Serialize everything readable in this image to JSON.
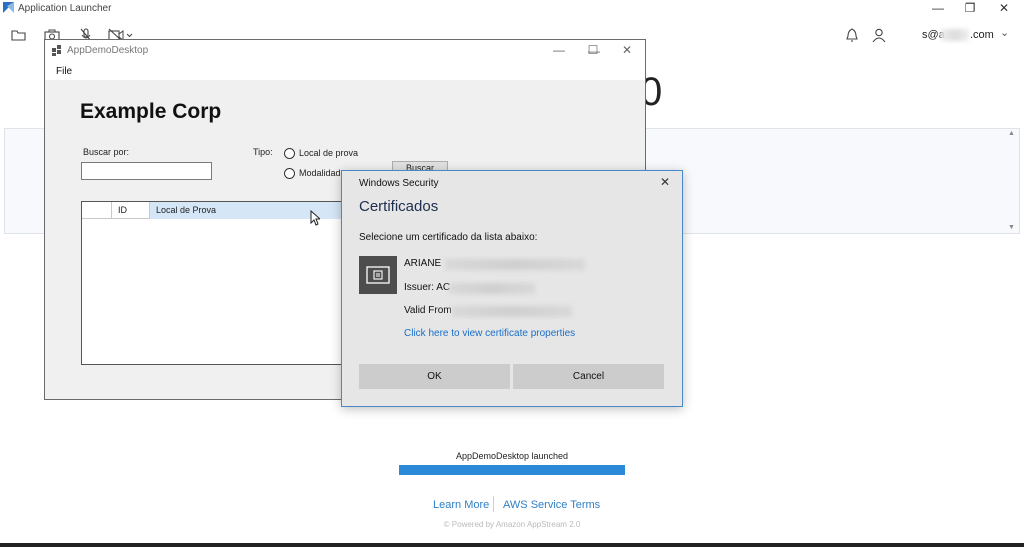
{
  "launcher": {
    "title": "Application Launcher",
    "window_controls": {
      "minimize": "—",
      "restore": "❐",
      "close": "✕"
    },
    "toolbar_icons": [
      "folder-icon",
      "camera-icon",
      "microphone-muted-icon",
      "video-muted-icon"
    ],
    "user": {
      "email_prefix": "s@a",
      "email_suffix": ".com",
      "caret": "⌄"
    },
    "background_number": "0",
    "status": {
      "launched_text": "AppDemoDesktop launched",
      "progress_percent": 100,
      "accent_color": "#2b8ad8"
    },
    "footer": {
      "learn_more": "Learn More",
      "service_terms": "AWS Service Terms",
      "powered_by": "© Powered by Amazon AppStream 2.0"
    }
  },
  "app_window": {
    "title": "AppDemoDesktop",
    "window_controls": {
      "minimize": "—",
      "maximize": "☐",
      "close": "✕"
    },
    "menu": {
      "file": "File"
    },
    "heading": "Example Corp",
    "search": {
      "label": "Buscar por:",
      "value": ""
    },
    "tipo": {
      "label": "Tipo:",
      "options": [
        {
          "label": "Local de prova",
          "selected": false
        },
        {
          "label": "Modalidade",
          "selected": false
        }
      ]
    },
    "buscar_button": "Buscar",
    "grid": {
      "columns": [
        "ID",
        "Local de Prova"
      ]
    }
  },
  "security_dialog": {
    "title": "Windows Security",
    "close": "✕",
    "heading": "Certificados",
    "instruction": "Selecione um certificado da lista abaixo:",
    "certificate": {
      "name": "ARIANE",
      "issuer_label": "Issuer: AC",
      "valid_from_label": "Valid From"
    },
    "properties_link": "Click here to view certificate properties",
    "ok_button": "OK",
    "cancel_button": "Cancel",
    "accent_color": "#4a88c7"
  }
}
